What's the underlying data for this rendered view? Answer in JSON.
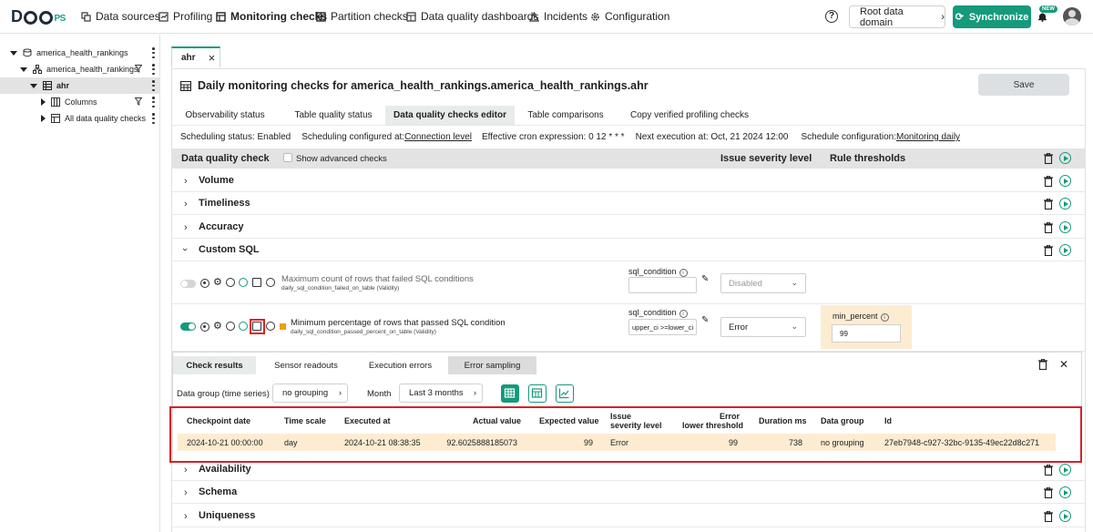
{
  "brand": {
    "logo_text_main": "DQO",
    "logo_text_sub": "PS",
    "accent": "#159a7c"
  },
  "nav": {
    "items": [
      {
        "label": "Data sources",
        "icon": "data-sources-icon"
      },
      {
        "label": "Profiling",
        "icon": "profiling-icon"
      },
      {
        "label": "Monitoring checks",
        "icon": "monitoring-icon",
        "active": true
      },
      {
        "label": "Partition checks",
        "icon": "partition-icon"
      },
      {
        "label": "Data quality dashboards",
        "icon": "dashboard-icon"
      },
      {
        "label": "Incidents",
        "icon": "warning-icon"
      },
      {
        "label": "Configuration",
        "icon": "gear-icon"
      }
    ],
    "help": "?",
    "domain": "Root data domain",
    "sync": "Synchronize",
    "new_badge": "NEW"
  },
  "tree": [
    {
      "label": "america_health_rankings",
      "icon": "database-icon"
    },
    {
      "label": "america_health_rankings",
      "icon": "schema-icon"
    },
    {
      "label": "ahr",
      "icon": "table-icon"
    },
    {
      "label": "Columns",
      "icon": "columns-icon"
    },
    {
      "label": "All data quality checks",
      "icon": "checks-icon"
    }
  ],
  "file_tab": {
    "label": "ahr",
    "close": "×"
  },
  "page": {
    "title": "Daily monitoring checks for america_health_rankings.america_health_rankings.ahr",
    "save": "Save"
  },
  "subtabs": [
    "Observability status",
    "Table quality status",
    "Data quality checks editor",
    "Table comparisons",
    "Copy verified profiling checks"
  ],
  "schedule": {
    "status": "Scheduling status: Enabled",
    "configured_label": "Scheduling configured at: ",
    "configured_value": "Connection level",
    "cron": "Effective cron expression: 0 12 * * *",
    "next": "Next execution at: Oct, 21 2024 12:00",
    "config_label": "Schedule configuration: ",
    "config_value": "Monitoring daily"
  },
  "grid_header": {
    "check": "Data quality check",
    "advanced": "Show advanced checks",
    "severity": "Issue severity level",
    "thresholds": "Rule thresholds"
  },
  "categories_top": [
    "Volume",
    "Timeliness",
    "Accuracy",
    "Custom SQL"
  ],
  "checks": [
    {
      "name": "Maximum count of rows that failed SQL conditions",
      "sub": "daily_sql_condition_failed_on_table (Validity)",
      "param_label": "sql_condition",
      "param_value": "",
      "severity": "Disabled"
    },
    {
      "name": "Minimum percentage of rows that passed SQL condition",
      "sub": "daily_sql_condition_passed_percent_on_table (Validity)",
      "param_label": "sql_condition",
      "param_value": "upper_ci >=lower_ci",
      "severity": "Error",
      "rule_label": "min_percent",
      "rule_value": "99"
    }
  ],
  "result_tabs": [
    "Check results",
    "Sensor readouts",
    "Execution errors",
    "Error sampling"
  ],
  "filters": {
    "group_label": "Data group (time series)",
    "group_value": "no grouping",
    "month_label": "Month",
    "month_value": "Last 3 months"
  },
  "results": {
    "headers": [
      "Checkpoint date",
      "Time scale",
      "Executed at",
      "Actual value",
      "Expected value",
      "Issue",
      "severity level",
      "Error",
      "lower threshold",
      "Duration ms",
      "Data group",
      "Id"
    ],
    "row": {
      "checkpoint": "2024-10-21 00:00:00",
      "scale": "day",
      "executed": "2024-10-21 08:38:35",
      "actual": "92.6025888185073",
      "expected": "99",
      "severity": "Error",
      "threshold": "99",
      "duration": "738",
      "group": "no grouping",
      "id": "27eb7948-c927-32bc-9135-49ec22d8c271"
    }
  },
  "categories_bottom": [
    "Availability",
    "Schema",
    "Uniqueness"
  ]
}
